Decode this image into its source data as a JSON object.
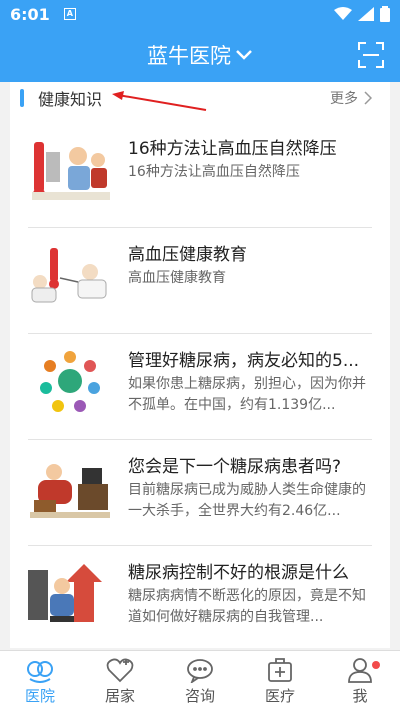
{
  "status_bar": {
    "time": "6:01",
    "notif_letter": "A"
  },
  "header": {
    "title": "蓝牛医院"
  },
  "section": {
    "title": "健康知识",
    "more_label": "更多"
  },
  "articles": [
    {
      "title": "16种方法让高血压自然降压",
      "desc": "16种方法让高血压自然降压"
    },
    {
      "title": "高血压健康教育",
      "desc": "高血压健康教育"
    },
    {
      "title": "管理好糖尿病，病友必知的5...",
      "desc": "如果你患上糖尿病，别担心，因为你并不孤单。在中国，约有1.139亿..."
    },
    {
      "title": "您会是下一个糖尿病患者吗?",
      "desc": "目前糖尿病已成为威胁人类生命健康的一大杀手，全世界大约有2.46亿..."
    },
    {
      "title": "糖尿病控制不好的根源是什么",
      "desc": "糖尿病病情不断恶化的原因，竟是不知道如何做好糖尿病的自我管理..."
    }
  ],
  "bottom_nav": [
    {
      "label": "医院",
      "icon": "hospital-icon",
      "active": true
    },
    {
      "label": "居家",
      "icon": "home-heart-icon"
    },
    {
      "label": "咨询",
      "icon": "chat-icon"
    },
    {
      "label": "医疗",
      "icon": "medical-kit-icon"
    },
    {
      "label": "我",
      "icon": "user-icon",
      "badge": true
    }
  ],
  "colors": {
    "primary": "#3aa2f5",
    "badge": "#f24b4b"
  }
}
